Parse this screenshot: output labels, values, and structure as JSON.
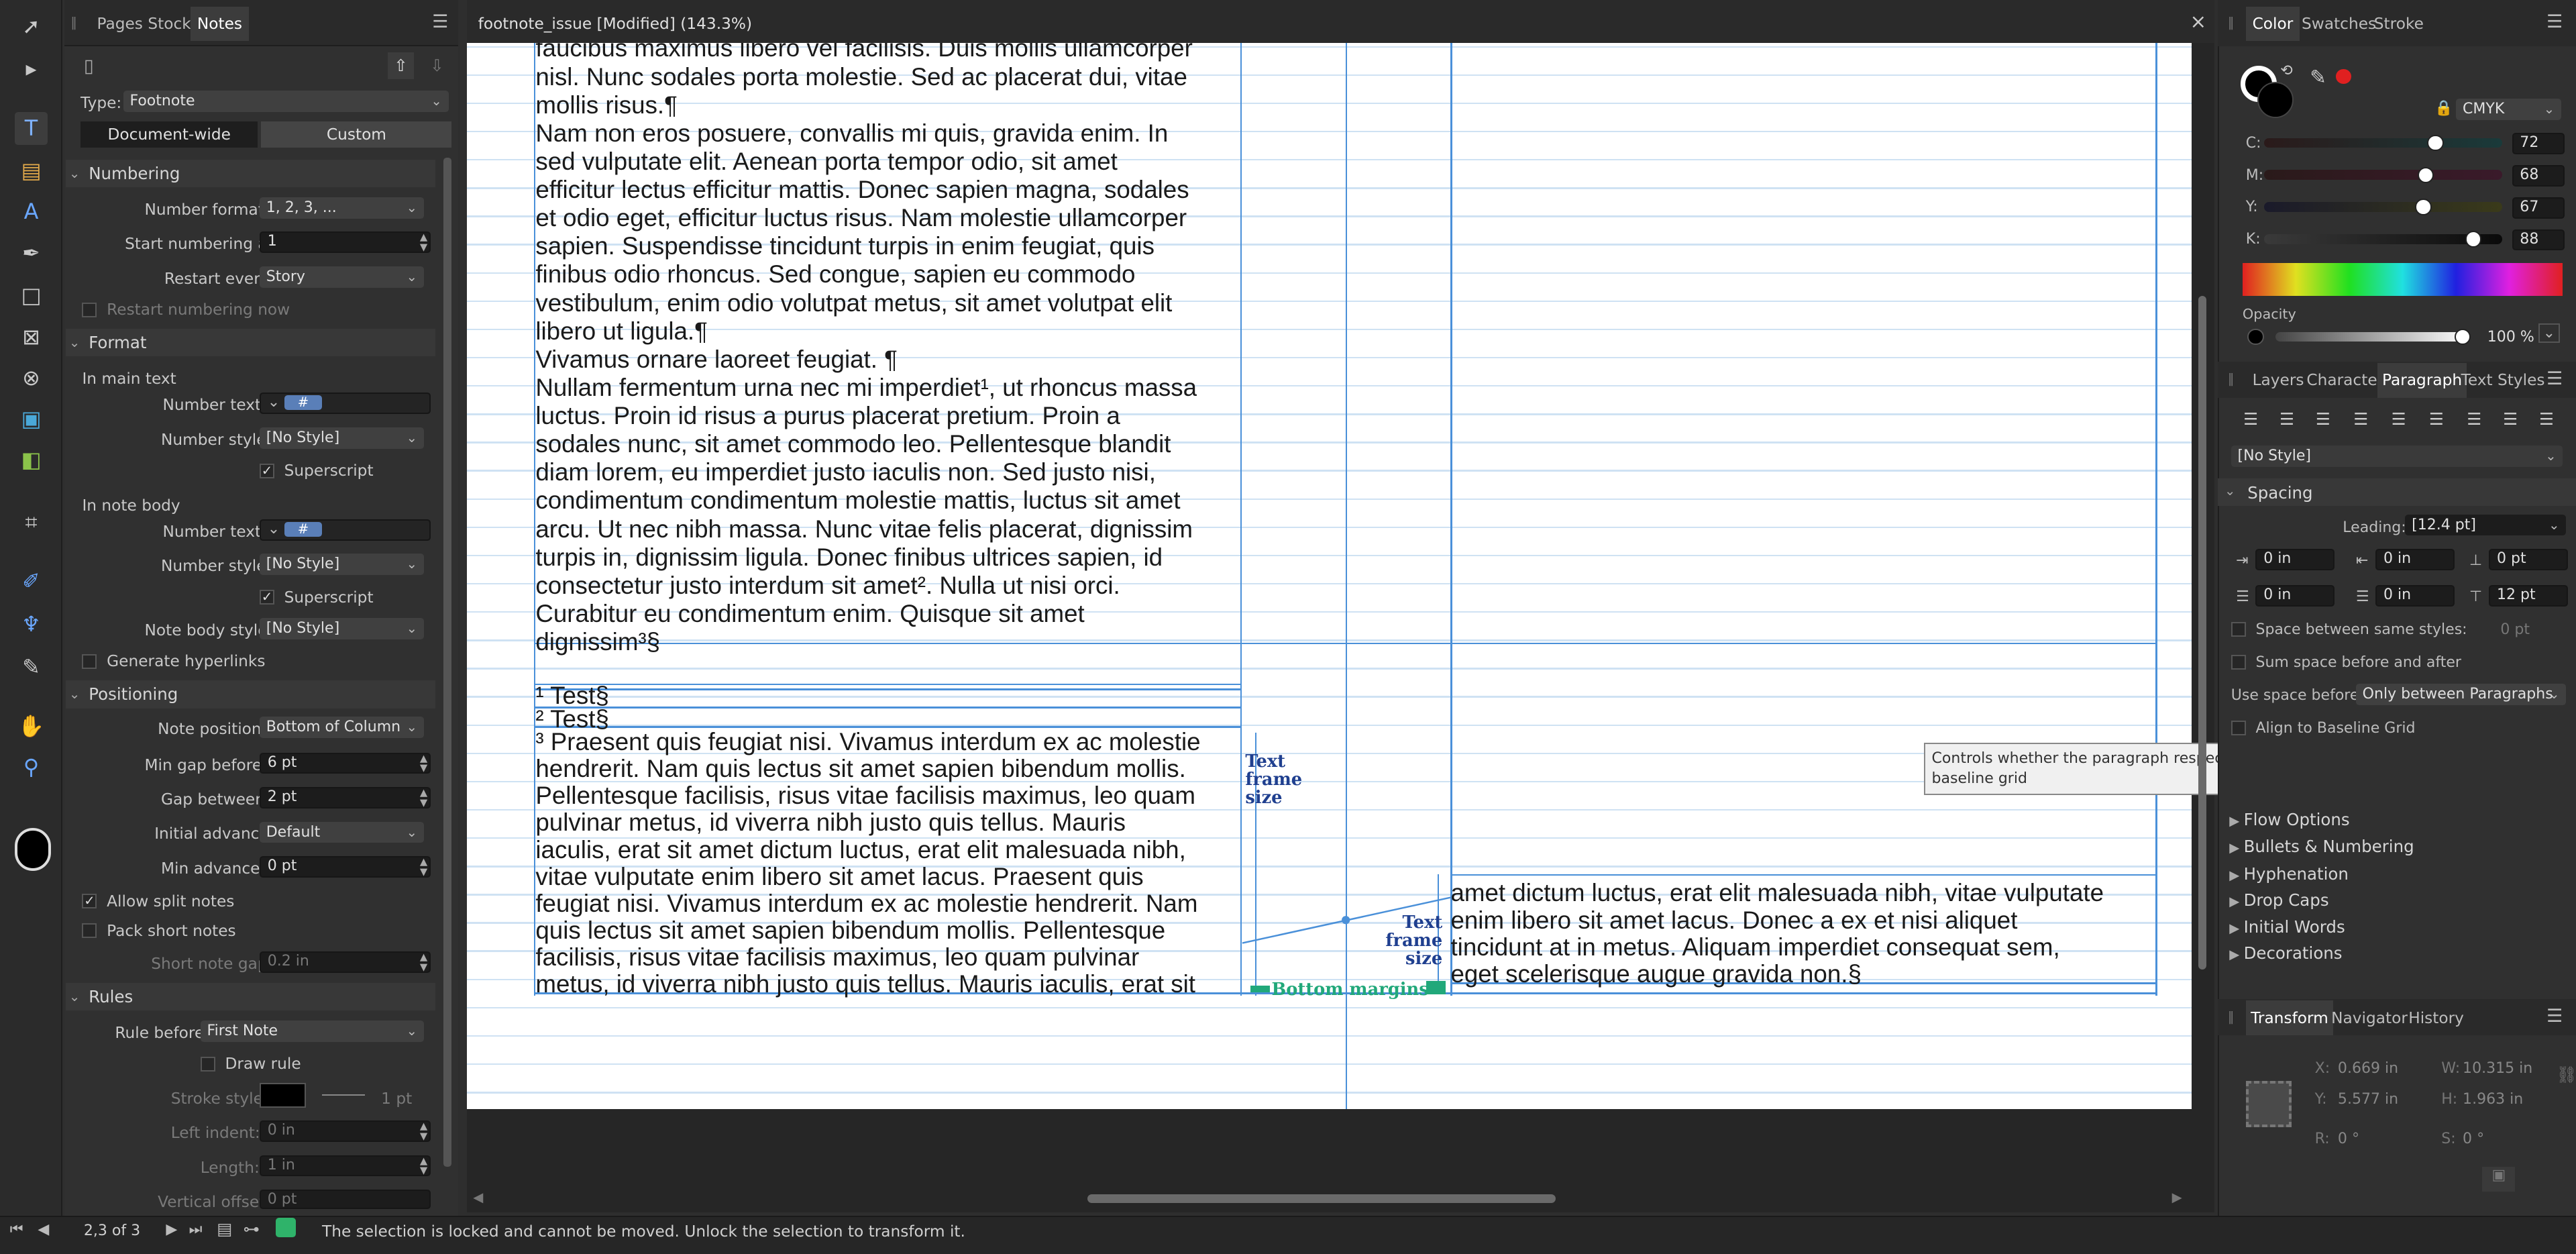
{
  "window": {
    "title": "footnote_issue [Modified] (143.3%)",
    "close_glyph": "×"
  },
  "left_panel": {
    "tabs": [
      "Pages",
      "Stock",
      "Notes"
    ],
    "type_label": "Type:",
    "type_value": "Footnote",
    "scope_tabs": [
      "Document-wide",
      "Custom"
    ],
    "numbering": {
      "title": "Numbering",
      "format_label": "Number format:",
      "format_value": "1, 2, 3, ...",
      "start_label": "Start numbering at:",
      "start_value": "1",
      "restart_label": "Restart every:",
      "restart_value": "Story",
      "restart_now": "Restart numbering now"
    },
    "format": {
      "title": "Format",
      "main_text": "In main text",
      "number_text_label": "Number text:",
      "number_text_value": "#",
      "number_style_label": "Number style:",
      "number_style_value": "[No Style]",
      "superscript": "Superscript",
      "note_body": "In note body",
      "note_body_style_label": "Note body style:",
      "note_body_style_value": "[No Style]",
      "generate_hyperlinks": "Generate hyperlinks"
    },
    "positioning": {
      "title": "Positioning",
      "note_position_label": "Note position:",
      "note_position_value": "Bottom of Column",
      "min_gap_label": "Min gap before:",
      "min_gap_value": "6 pt",
      "gap_between_label": "Gap between:",
      "gap_between_value": "2 pt",
      "initial_advance_label": "Initial advance:",
      "initial_advance_value": "Default",
      "min_advance_label": "Min advance:",
      "min_advance_value": "0 pt",
      "allow_split": "Allow split notes",
      "pack_short": "Pack short notes",
      "short_gap_label": "Short note gap:",
      "short_gap_value": "0.2 in"
    },
    "rules": {
      "title": "Rules",
      "rule_before_label": "Rule before:",
      "rule_before_value": "First Note",
      "draw_rule": "Draw rule",
      "stroke_style_label": "Stroke style:",
      "stroke_width": "1 pt",
      "left_indent_label": "Left indent:",
      "left_indent_value": "0 in",
      "length_label": "Length:",
      "length_value": "1 in",
      "vertical_offset_label": "Vertical offset:",
      "vertical_offset_value": "0 pt"
    }
  },
  "document": {
    "col1_lines": [
      "faucibus maximus libero vel facilisis. Duis mollis ullamcorper",
      "nisl. Nunc sodales porta molestie. Sed ac placerat dui, vitae",
      "mollis risus.¶",
      "Nam non eros posuere, convallis mi quis, gravida enim. In",
      "sed vulputate elit. Aenean porta tempor odio, sit amet",
      "efficitur lectus efficitur mattis. Donec sapien magna, sodales",
      "et odio eget, efficitur luctus risus. Nam molestie ullamcorper",
      "sapien. Suspendisse tincidunt turpis in enim feugiat, quis",
      "finibus odio rhoncus. Sed congue, sapien eu commodo",
      "vestibulum, enim odio volutpat metus, sit amet volutpat elit",
      "libero ut ligula.¶",
      "Vivamus ornare laoreet feugiat. ¶",
      "Nullam fermentum urna nec mi imperdiet¹, ut rhoncus massa",
      "luctus. Proin id risus a purus placerat pretium. Proin a",
      "sodales nunc, sit amet commodo leo. Pellentesque blandit",
      "diam lorem, eu imperdiet justo iaculis non. Sed justo nisi,",
      "condimentum condimentum molestie mattis, luctus sit amet",
      "arcu. Ut nec nibh massa. Nunc vitae felis placerat, dignissim",
      "turpis in, dignissim ligula. Donec finibus ultrices sapien, id",
      "consectetur justo interdum sit amet². Nulla ut nisi orci.",
      "Curabitur eu condimentum enim. Quisque sit amet",
      "dignissim³§"
    ],
    "footnotes": [
      "¹ Test§",
      "² Test§"
    ],
    "fn3_lines": [
      "³ Praesent quis feugiat nisi. Vivamus interdum ex ac molestie",
      "hendrerit. Nam quis lectus sit amet sapien bibendum mollis.",
      "Pellentesque facilisis, risus vitae facilisis maximus, leo quam",
      "pulvinar metus, id viverra nibh justo quis tellus. Mauris",
      "iaculis, erat sit amet dictum luctus, erat elit malesuada nibh,",
      "vitae vulputate enim libero sit amet lacus. Praesent quis",
      "feugiat nisi. Vivamus interdum ex ac molestie hendrerit. Nam",
      "quis lectus sit amet sapien bibendum mollis. Pellentesque",
      "facilisis, risus vitae facilisis maximus, leo quam pulvinar",
      "metus, id viverra nibh justo quis tellus. Mauris iaculis, erat sit"
    ],
    "col3_lines": [
      "amet dictum luctus, erat elit malesuada nibh, vitae vulputate",
      "enim libero sit amet lacus. Donec a ex et nisi aliquet",
      "tincidunt at in metus. Aliquam imperdiet consequat sem,",
      "eget scelerisque augue gravida non.§"
    ],
    "annotations": {
      "text_frame_size_1": "Text frame size",
      "text_frame_size_2": "Text frame size",
      "bottom_margins": "Bottom margins"
    }
  },
  "tooltip": "Controls whether the paragraph respects the baseline grid",
  "color_panel": {
    "tabs": [
      "Color",
      "Swatches",
      "Stroke"
    ],
    "model": "CMYK",
    "channels": [
      {
        "label": "C:",
        "value": "72",
        "pos": 0.72
      },
      {
        "label": "M:",
        "value": "68",
        "pos": 0.68
      },
      {
        "label": "Y:",
        "value": "67",
        "pos": 0.67
      },
      {
        "label": "K:",
        "value": "88",
        "pos": 0.88
      }
    ],
    "opacity_label": "Opacity",
    "opacity_value": "100 %"
  },
  "paragraph_panel": {
    "tabs": [
      "Layers",
      "Character",
      "Paragraph",
      "Text Styles"
    ],
    "style_value": "[No Style]",
    "spacing_title": "Spacing",
    "leading_label": "Leading:",
    "leading_value": "[12.4 pt]",
    "indent_values": [
      "0 in",
      "0 in",
      "0 pt"
    ],
    "indent_values2": [
      "0 in",
      "0 in",
      "12 pt"
    ],
    "space_same_styles": "Space between same styles:",
    "space_same_value": "0 pt",
    "sum_space": "Sum space before and after",
    "use_space_before_label": "Use space before:",
    "use_space_before_value": "Only between Paragraphs",
    "align_baseline": "Align to Baseline Grid",
    "collapsed_sections": [
      "Flow Options",
      "Bullets & Numbering",
      "Hyphenation",
      "Drop Caps",
      "Initial Words",
      "Decorations"
    ]
  },
  "transform_panel": {
    "tabs": [
      "Transform",
      "Navigator",
      "History"
    ],
    "x_label": "X:",
    "x_value": "0.669 in",
    "w_label": "W:",
    "w_value": "10.315 in",
    "y_label": "Y:",
    "y_value": "5.577 in",
    "h_label": "H:",
    "h_value": "1.963 in",
    "r_label": "R:",
    "r_value": "0 °",
    "s_label": "S:",
    "s_value": "0 °"
  },
  "status": {
    "page": "2,3 of 3",
    "message": "The selection is locked and cannot be moved. Unlock the selection to transform it."
  }
}
